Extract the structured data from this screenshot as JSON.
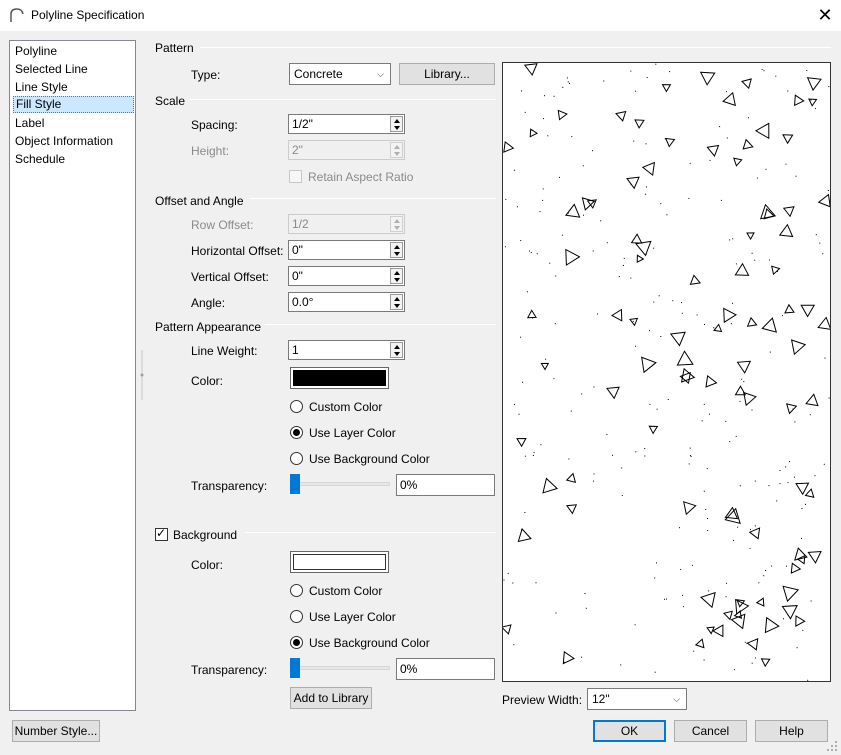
{
  "window": {
    "title": "Polyline Specification",
    "close_glyph": "✕"
  },
  "nav": {
    "items": [
      {
        "label": "Polyline"
      },
      {
        "label": "Selected Line"
      },
      {
        "label": "Line Style"
      },
      {
        "label": "Fill Style"
      },
      {
        "label": "Label"
      },
      {
        "label": "Object Information"
      },
      {
        "label": "Schedule"
      }
    ],
    "selected": "Fill Style"
  },
  "pattern": {
    "header": "Pattern",
    "type_label": "Type:",
    "type_value": "Concrete",
    "library_button": "Library..."
  },
  "scale": {
    "header": "Scale",
    "spacing_label": "Spacing:",
    "spacing_value": "1/2\"",
    "height_label": "Height:",
    "height_value": "2\"",
    "retain_label": "Retain Aspect Ratio"
  },
  "offset": {
    "header": "Offset and Angle",
    "row_label": "Row Offset:",
    "row_value": "1/2",
    "horiz_label": "Horizontal Offset:",
    "horiz_value": "0\"",
    "vert_label": "Vertical Offset:",
    "vert_value": "0\"",
    "angle_label": "Angle:",
    "angle_value": "0.0°"
  },
  "appearance": {
    "header": "Pattern Appearance",
    "lineweight_label": "Line Weight:",
    "lineweight_value": "1",
    "color_label": "Color:",
    "color_hex": "#000000",
    "custom_color": "Custom Color",
    "layer_color": "Use Layer Color",
    "bg_color": "Use Background Color",
    "selected_option": "Use Layer Color",
    "transparency_label": "Transparency:",
    "transparency_value": "0%"
  },
  "background": {
    "checkbox_label": "Background",
    "checked": true,
    "color_label": "Color:",
    "color_hex": "#ffffff",
    "custom_color": "Custom Color",
    "layer_color": "Use Layer Color",
    "bg_color": "Use Background Color",
    "selected_option": "Use Background Color",
    "transparency_label": "Transparency:",
    "transparency_value": "0%",
    "add_library_button": "Add to Library"
  },
  "preview": {
    "width_label": "Preview Width:",
    "width_value": "12\""
  },
  "footer": {
    "number_style": "Number Style...",
    "ok": "OK",
    "cancel": "Cancel",
    "help": "Help"
  }
}
